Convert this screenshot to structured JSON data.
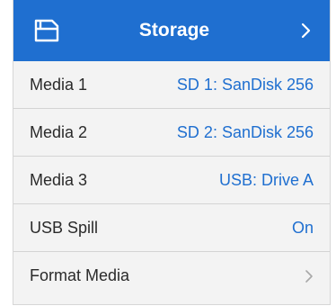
{
  "header": {
    "title": "Storage",
    "icon": "storage-card-icon",
    "accent_color": "#1f6fd0"
  },
  "rows": [
    {
      "label": "Media 1",
      "value": "SD 1: SanDisk 256"
    },
    {
      "label": "Media 2",
      "value": "SD 2: SanDisk 256"
    },
    {
      "label": "Media 3",
      "value": "USB: Drive A"
    },
    {
      "label": "USB Spill",
      "value": "On"
    },
    {
      "label": "Format Media",
      "value": ""
    }
  ]
}
